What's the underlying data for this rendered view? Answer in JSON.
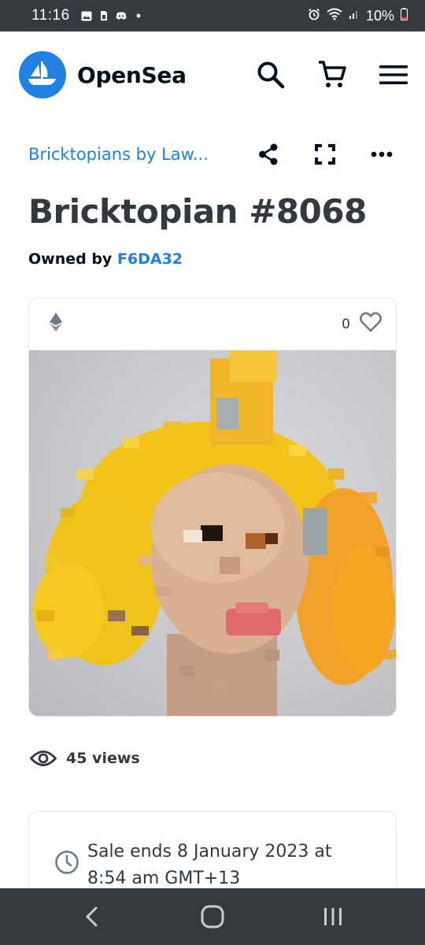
{
  "status_bar": {
    "time": "11:16",
    "battery": "10%",
    "left_icons": [
      "gallery-icon",
      "sim-icon",
      "discord-icon",
      "dot-icon"
    ],
    "right_icons": [
      "alarm-icon",
      "wifi-icon",
      "signal-icon",
      "battery-icon"
    ]
  },
  "nav": {
    "brand": "OpenSea",
    "brand_color": "#2081e2",
    "icons": [
      "search-icon",
      "cart-icon",
      "menu-icon"
    ]
  },
  "breadcrumb": {
    "collection": "Bricktopians by Law..."
  },
  "item": {
    "title": "Bricktopian #8068",
    "owner_prefix": "Owned by",
    "owner": "F6DA32",
    "chain_icon": "ethereum-icon",
    "favorites": "0"
  },
  "stats": {
    "views": "45 views"
  },
  "sale": {
    "text": "Sale ends 8 January 2023 at 8:54 am GMT+13"
  },
  "android_nav": {
    "icons": [
      "back-icon",
      "home-icon",
      "recents-icon"
    ]
  },
  "colors": {
    "accent": "#2081e2",
    "text": "#353840",
    "system_bar": "#36393d",
    "border": "#e5e8eb"
  }
}
